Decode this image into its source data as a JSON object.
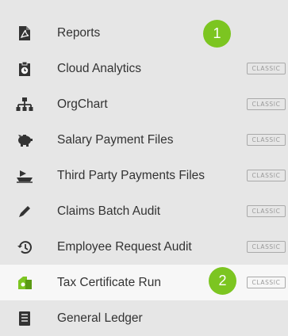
{
  "menu": {
    "items": [
      {
        "label": "Reports",
        "icon": "pdf-file-icon",
        "badge": ""
      },
      {
        "label": "Cloud Analytics",
        "icon": "clipboard-clock-icon",
        "badge": "CLASSIC"
      },
      {
        "label": "OrgChart",
        "icon": "org-chart-icon",
        "badge": "CLASSIC"
      },
      {
        "label": "Salary Payment Files",
        "icon": "piggy-bank-icon",
        "badge": "CLASSIC"
      },
      {
        "label": "Third Party Payments Files",
        "icon": "ship-icon",
        "badge": "CLASSIC"
      },
      {
        "label": "Claims Batch Audit",
        "icon": "pencil-icon",
        "badge": "CLASSIC"
      },
      {
        "label": "Employee Request Audit",
        "icon": "history-icon",
        "badge": "CLASSIC"
      },
      {
        "label": "Tax Certificate Run",
        "icon": "certificate-icon",
        "badge": "CLASSIC"
      },
      {
        "label": "General Ledger",
        "icon": "ledger-icon",
        "badge": ""
      }
    ]
  },
  "steps": {
    "first": "1",
    "second": "2"
  },
  "colors": {
    "accent": "#7cc521",
    "icon": "#333333",
    "active_icon": "#7cc521"
  }
}
